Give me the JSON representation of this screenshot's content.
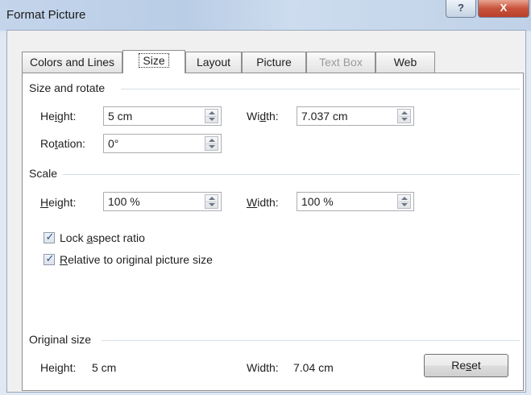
{
  "window": {
    "title": "Format Picture",
    "help_label": "?",
    "close_label": "X"
  },
  "tabs": [
    {
      "label": "Colors and Lines"
    },
    {
      "label": "Size",
      "active": true
    },
    {
      "label": "Layout"
    },
    {
      "label": "Picture"
    },
    {
      "label": "Text Box",
      "disabled": true
    },
    {
      "label": "Web"
    }
  ],
  "size_rotate": {
    "title": "Size and rotate",
    "height_label": "Height:",
    "height_value": "5 cm",
    "width_label": "Width:",
    "width_value": "7.037 cm",
    "rotation_label": "Rotation:",
    "rotation_value": "0°"
  },
  "scale": {
    "title": "Scale",
    "height_label": "Height:",
    "height_value": "100 %",
    "width_label": "Width:",
    "width_value": "100 %",
    "lock_aspect_label": "Lock aspect ratio",
    "lock_aspect_checked": true,
    "relative_label": "Relative to original picture size",
    "relative_checked": true
  },
  "original_size": {
    "title": "Original size",
    "height_label": "Height:",
    "height_value": "5 cm",
    "width_label": "Width:",
    "width_value": "7.04 cm",
    "reset_label": "Reset"
  },
  "colors": {
    "close_button": "#c8533a",
    "check_mark": "#2a4f8f",
    "group_line": "#d5dfe5"
  }
}
